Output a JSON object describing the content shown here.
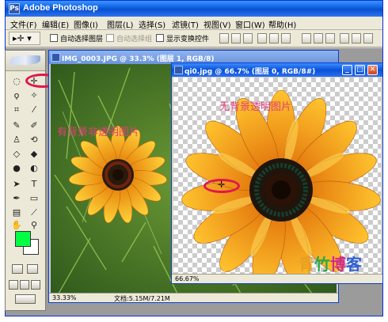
{
  "app": {
    "title": "Adobe Photoshop"
  },
  "menu": [
    "文件(F)",
    "编辑(E)",
    "图像(I)",
    "图层(L)",
    "选择(S)",
    "滤镜(T)",
    "视图(V)",
    "窗口(W)",
    "帮助(H)"
  ],
  "options": {
    "auto_select_layer": "自动选择图层",
    "auto_select_group": "自动选择组",
    "show_transform": "显示变换控件"
  },
  "doc1": {
    "title": "IMG_0003.JPG @ 33.3% (图层 1, RGB/8)",
    "overlay_text": "有背景非透明图片",
    "zoom": "33.33%",
    "doc_size": "文档:5.15M/7.21M"
  },
  "doc2": {
    "title": "qi0.jpg @ 66.7% (图层 0, RGB/8#)",
    "overlay_text": "无背景透明图片",
    "zoom": "66.67%",
    "watermark": "青竹博客"
  },
  "colors": {
    "foreground": "#00ff44",
    "background": "#ffffff",
    "accent": "#0a52d8",
    "highlight": "#e0164d"
  },
  "icons": [
    "move-tool-icon",
    "marquee-tool-icon",
    "lasso-tool-icon",
    "crop-tool-icon",
    "brush-tool-icon",
    "stamp-tool-icon",
    "eraser-tool-icon",
    "gradient-tool-icon",
    "blur-tool-icon",
    "dodge-tool-icon",
    "path-select-icon",
    "type-tool-icon",
    "pen-tool-icon",
    "shape-tool-icon",
    "notes-tool-icon",
    "eyedropper-tool-icon",
    "hand-tool-icon",
    "zoom-tool-icon"
  ]
}
